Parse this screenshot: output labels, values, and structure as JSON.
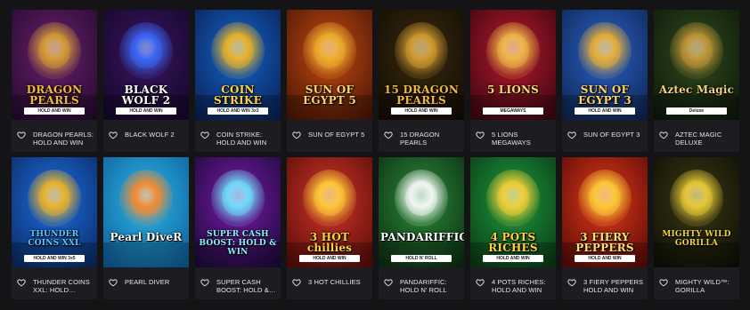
{
  "games": [
    {
      "title": "DRAGON PEARLS: HOLD AND WIN",
      "logo": "DRAGON PEARLS",
      "sub": "HOLD AND WIN",
      "bg1": "#6b1f6f",
      "bg2": "#240a2e",
      "accent": "#d9a233",
      "logoColor": "#f0b93a"
    },
    {
      "title": "BLACK WOLF 2",
      "logo": "BLACK WOLF 2",
      "sub": "HOLD AND WIN",
      "bg1": "#3a1460",
      "bg2": "#14082a",
      "accent": "#3a6cff",
      "logoColor": "#ffffff"
    },
    {
      "title": "COIN STRIKE: HOLD AND WIN",
      "logo": "COIN STRIKE",
      "sub": "HOLD AND WIN 3x3",
      "bg1": "#1466c9",
      "bg2": "#0a1f55",
      "accent": "#f5b820",
      "logoColor": "#ffd24a"
    },
    {
      "title": "SUN OF EGYPT 5",
      "logo": "SUN OF EGYPT 5",
      "sub": "",
      "bg1": "#c24a12",
      "bg2": "#4a1605",
      "accent": "#f2b431",
      "logoColor": "#ffd56a"
    },
    {
      "title": "15 DRAGON PEARLS",
      "logo": "15 DRAGON PEARLS",
      "sub": "HOLD AND WIN",
      "bg1": "#3a2a0e",
      "bg2": "#120c04",
      "accent": "#d9a233",
      "logoColor": "#f0b93a"
    },
    {
      "title": "5 LIONS MEGAWAYS",
      "logo": "5 LIONS",
      "sub": "MEGAWAYS",
      "bg1": "#b81a2c",
      "bg2": "#3a0610",
      "accent": "#f2c14a",
      "logoColor": "#ffd86a"
    },
    {
      "title": "SUN OF EGYPT 3",
      "logo": "SUN OF EGYPT 3",
      "sub": "HOLD AND WIN",
      "bg1": "#2a62c9",
      "bg2": "#0e2552",
      "accent": "#f2b431",
      "logoColor": "#ffd56a"
    },
    {
      "title": "AZTEC MAGIC DELUXE",
      "logo": "Aztec Magic",
      "sub": "Deluxe",
      "bg1": "#2e4a1e",
      "bg2": "#0e180a",
      "accent": "#c99a3a",
      "logoColor": "#f2d27a"
    },
    {
      "title": "THUNDER COINS XXL: HOLD…",
      "logo": "THUNDER COINS XXL",
      "sub": "HOLD AND WIN 3x5",
      "bg1": "#1e6fe0",
      "bg2": "#0a2a66",
      "accent": "#f5b820",
      "logoColor": "#5cc6ff"
    },
    {
      "title": "PEARL DIVER",
      "logo": "Pearl DiveR",
      "sub": "",
      "bg1": "#2bb6e8",
      "bg2": "#0f5f9a",
      "accent": "#ff8a2a",
      "logoColor": "#ffffff"
    },
    {
      "title": "SUPER CASH BOOST: HOLD &…",
      "logo": "SUPER CASH BOOST: HOLD & WIN",
      "sub": "",
      "bg1": "#7a1aa8",
      "bg2": "#1a0a3a",
      "accent": "#6fe8ff",
      "logoColor": "#8af0ff"
    },
    {
      "title": "3 HOT CHILLIES",
      "logo": "3 HOT chillies",
      "sub": "HOLD AND WIN",
      "bg1": "#d0362a",
      "bg2": "#5a0c08",
      "accent": "#ffd23a",
      "logoColor": "#ffd23a"
    },
    {
      "title": "PANDARIFFIC: HOLD N' ROLL",
      "logo": "PANDARIFFIC",
      "sub": "HOLD N' ROLL",
      "bg1": "#2c8a3a",
      "bg2": "#0c2e12",
      "accent": "#ffffff",
      "logoColor": "#ffffff"
    },
    {
      "title": "4 POTS RICHES: HOLD AND WIN",
      "logo": "4 POTS RICHES",
      "sub": "HOLD AND WIN",
      "bg1": "#1f9a3c",
      "bg2": "#0a3a16",
      "accent": "#ffd23a",
      "logoColor": "#ffd23a"
    },
    {
      "title": "3 FIERY PEPPERS HOLD AND WIN",
      "logo": "3 FIERY PEPPERS",
      "sub": "HOLD AND WIN",
      "bg1": "#e03a1a",
      "bg2": "#5a0a06",
      "accent": "#ffd23a",
      "logoColor": "#ffe06a"
    },
    {
      "title": "MIGHTY WILD™: GORILLA",
      "logo": "MIGHTY WILD GORILLA",
      "sub": "",
      "bg1": "#3a3a14",
      "bg2": "#0e0e06",
      "accent": "#f2d23a",
      "logoColor": "#f2d23a"
    }
  ],
  "colors": {
    "page_bg": "#141416",
    "card_bg": "#1d1d21",
    "text": "#e6e6e6"
  },
  "icons": {
    "favorite": "heart-outline-icon"
  }
}
